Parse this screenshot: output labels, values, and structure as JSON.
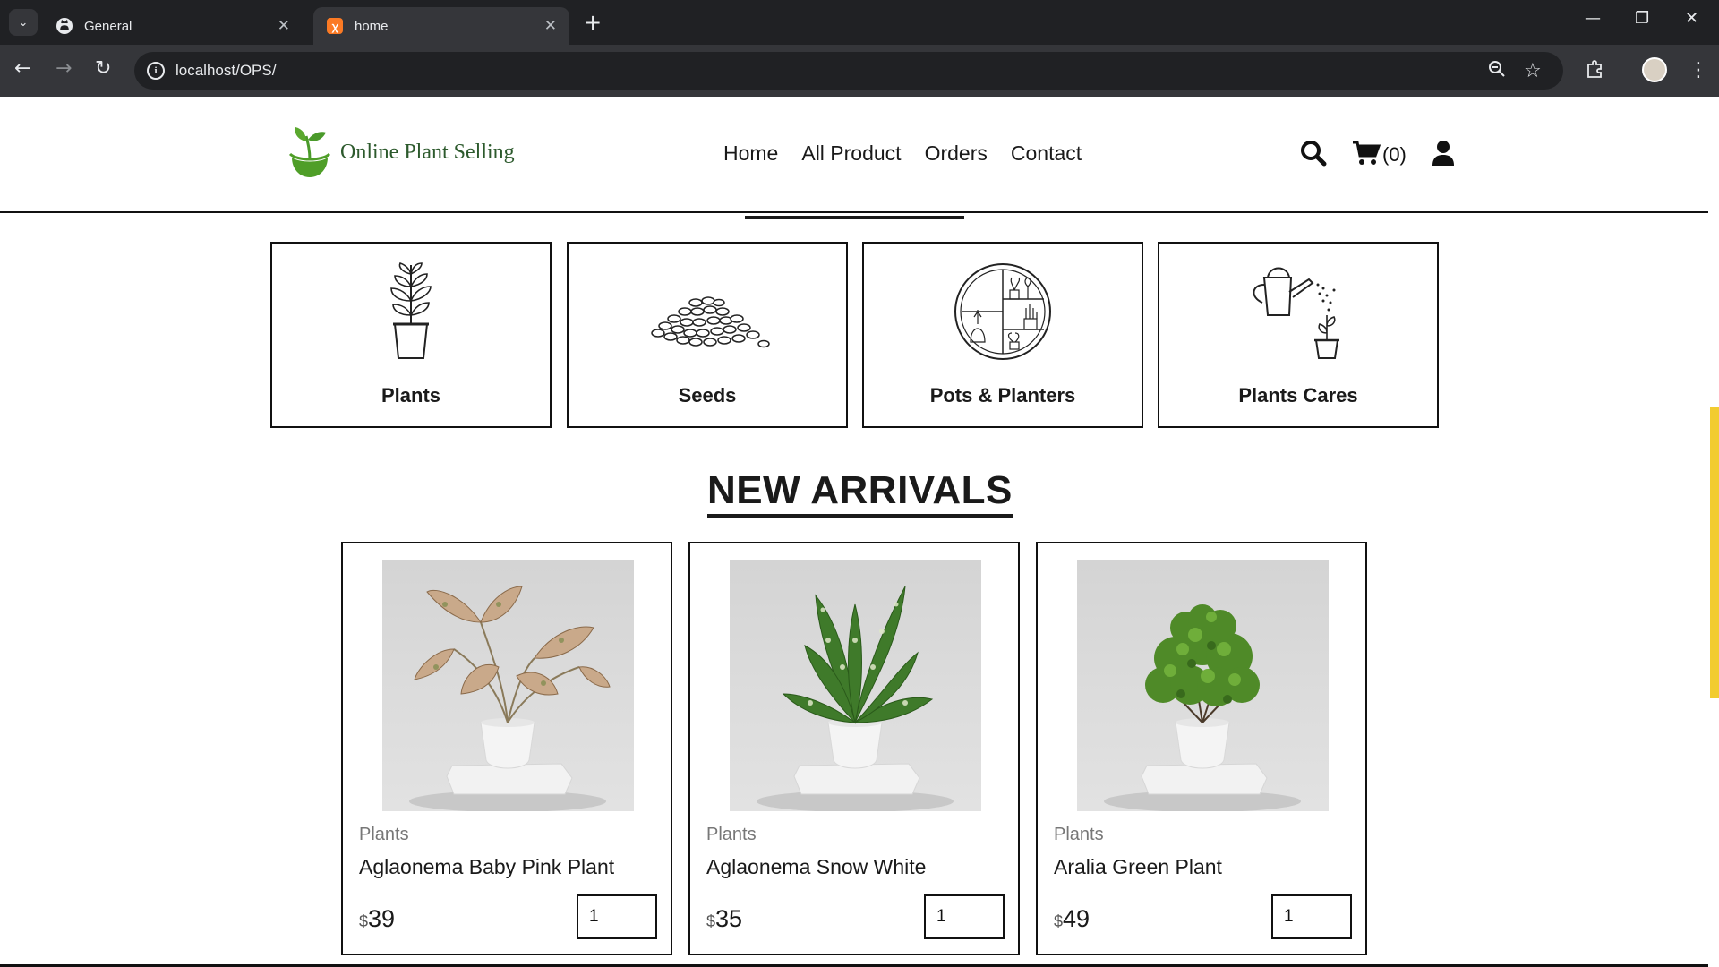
{
  "browser": {
    "tabs": [
      {
        "title": "General",
        "icon": "github-icon",
        "active": false
      },
      {
        "title": "home",
        "icon": "xampp-icon",
        "active": true
      }
    ],
    "url": "localhost/OPS/"
  },
  "site": {
    "logo_text": "Online Plant Selling",
    "nav": [
      "Home",
      "All Product",
      "Orders",
      "Contact"
    ],
    "cart_count": "(0)"
  },
  "categories": [
    {
      "label": "Plants",
      "icon": "plant-icon"
    },
    {
      "label": "Seeds",
      "icon": "seeds-icon"
    },
    {
      "label": "Pots & Planters",
      "icon": "pots-icon"
    },
    {
      "label": "Plants Cares",
      "icon": "watering-can-icon"
    }
  ],
  "section_title": "NEW ARRIVALS",
  "products": [
    {
      "category": "Plants",
      "name": "Aglaonema Baby Pink Plant",
      "currency": "$",
      "price": "39",
      "qty": "1"
    },
    {
      "category": "Plants",
      "name": "Aglaonema Snow White",
      "currency": "$",
      "price": "35",
      "qty": "1"
    },
    {
      "category": "Plants",
      "name": "Aralia Green Plant",
      "currency": "$",
      "price": "49",
      "qty": "1"
    }
  ],
  "colors": {
    "accent": "#f2cc30",
    "logo_green": "#5aa82e",
    "border": "#111111"
  }
}
